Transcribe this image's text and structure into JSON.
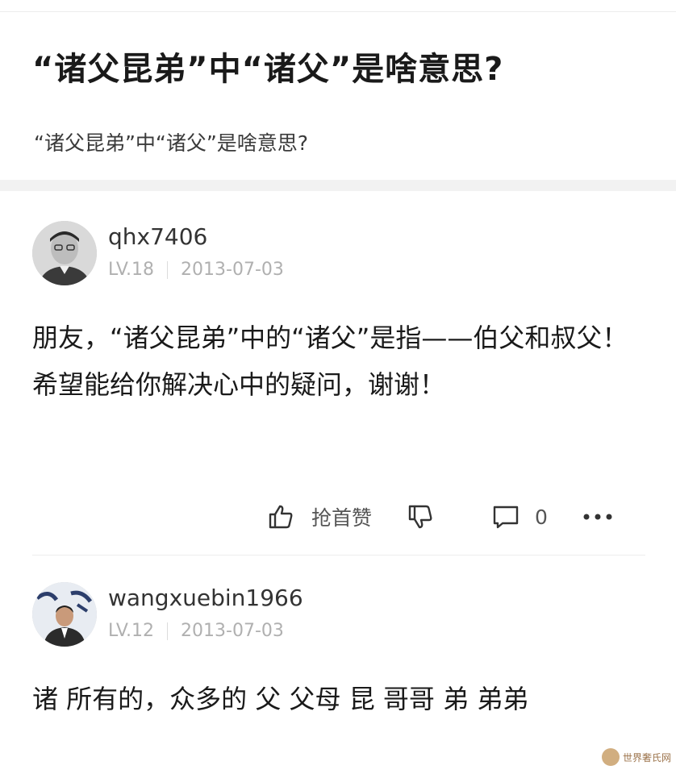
{
  "question": {
    "title": "“诸父昆弟”中“诸父”是啥意思?",
    "description": "“诸父昆弟”中“诸父”是啥意思?"
  },
  "answers": [
    {
      "username": "qhx7406",
      "level": "LV.18",
      "date": "2013-07-03",
      "avatar_icon": "user-avatar-portrait",
      "text": "朋友，“诸父昆弟”中的“诸父”是指——伯父和叔父！ 希望能给你解决心中的疑问，谢谢！",
      "actions": {
        "like_label": "抢首赞",
        "comment_count": "0"
      }
    },
    {
      "username": "wangxuebin1966",
      "level": "LV.12",
      "date": "2013-07-03",
      "avatar_icon": "user-avatar-photo",
      "text": "诸 所有的，众多的 父 父母 昆 哥哥 弟 弟弟"
    }
  ],
  "watermark": {
    "text": "世界奢氏网"
  },
  "colors": {
    "title": "#1a1a1a",
    "meta": "#b0b0b0",
    "section_bg": "#f2f2f2"
  }
}
